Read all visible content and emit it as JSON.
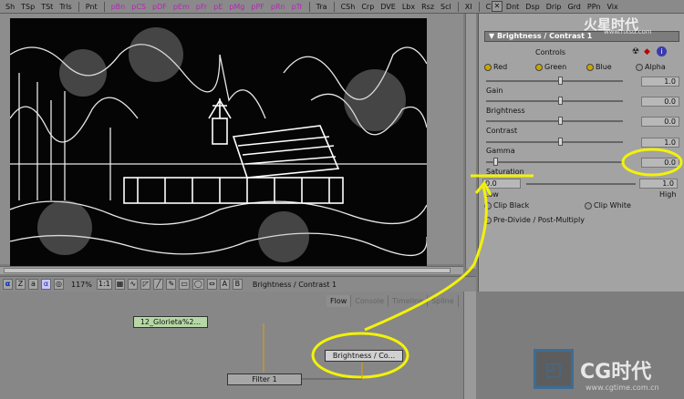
{
  "toolbar": {
    "items": [
      "Sh",
      "TSp",
      "TSt",
      "Trls",
      "Pnt",
      "pBn",
      "pCS",
      "pDF",
      "pEm",
      "pFr",
      "pE",
      "pMg",
      "pPF",
      "pRn",
      "pTr",
      "Tra",
      "CSh",
      "Crp",
      "DVE",
      "Lbx",
      "Rsz",
      "Scl",
      "XI",
      "CPn",
      "Dnt",
      "Dsp",
      "Drip",
      "Grd",
      "PPn",
      "Vix"
    ],
    "close": "✕"
  },
  "viewbar": {
    "zoom": "117%",
    "ratio": "1:1",
    "btn_a": "A",
    "btn_b": "B",
    "active_tool": "Brightness / Contrast 1",
    "alpha_glyph": "α",
    "z_glyph": "Z",
    "a_glyph": "a"
  },
  "flow_tabs": [
    "Flow",
    "Console",
    "Timeline",
    "Spline"
  ],
  "nodes": {
    "loader": "12_Glorieta%2...",
    "filter": "Filter 1",
    "bc": "Brightness / Co..."
  },
  "panel": {
    "title": "Brightness / Contrast 1",
    "controls_label": "Controls",
    "channels": [
      "Red",
      "Green",
      "Blue",
      "Alpha"
    ],
    "params": [
      {
        "label": "Gain",
        "value": "1.0"
      },
      {
        "label": "Brightness",
        "value": "0.0"
      },
      {
        "label": "Contrast",
        "value": "0.0"
      },
      {
        "label": "Gamma",
        "value": "1.0"
      },
      {
        "label": "Saturation",
        "value": "0.0"
      }
    ],
    "low_value": "0.0",
    "high_value": "1.0",
    "low_label": "Low",
    "high_label": "High",
    "clip_black": "Clip Black",
    "clip_white": "Clip White",
    "premul": "Pre-Divide / Post-Multiply"
  },
  "logo": {
    "site": "www.hxsd.com",
    "cg": "CG时代",
    "cg_site": "www.cgtime.com.cn",
    "brand": "火星时代"
  },
  "colors": {
    "highlight": "#f2f20a",
    "channel_check": "#c8a600"
  }
}
